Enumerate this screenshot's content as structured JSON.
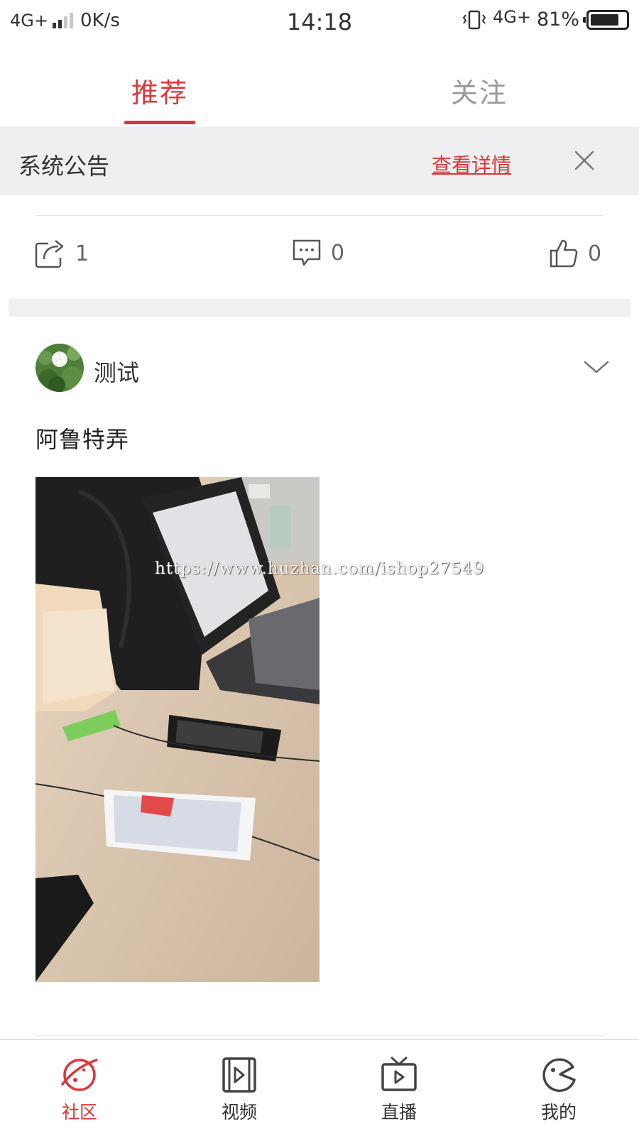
{
  "status_bar": {
    "network_left": "4G+",
    "speed": "0K/s",
    "time": "14:18",
    "network_right": "4G+",
    "battery": "81%",
    "battery_level": 0.81
  },
  "top_tabs": [
    {
      "label": "推荐",
      "active": true
    },
    {
      "label": "关注",
      "active": false
    }
  ],
  "notice": {
    "title": "系统公告",
    "link": "查看详情"
  },
  "action_bar": {
    "share_count": "1",
    "comment_count": "0",
    "like_count": "0"
  },
  "post": {
    "username": "测试",
    "text": "阿鲁特弄",
    "watermark": "https://www.huzhan.com/ishop27549"
  },
  "bottom_nav": [
    {
      "label": "社区",
      "icon": "community-icon",
      "active": true
    },
    {
      "label": "视频",
      "icon": "video-icon",
      "active": false
    },
    {
      "label": "直播",
      "icon": "live-tv-icon",
      "active": false
    },
    {
      "label": "我的",
      "icon": "profile-icon",
      "active": false
    }
  ],
  "colors": {
    "accent": "#d9383a",
    "inactive_tab": "#9a9a9a",
    "notice_bg": "#efeff1"
  }
}
